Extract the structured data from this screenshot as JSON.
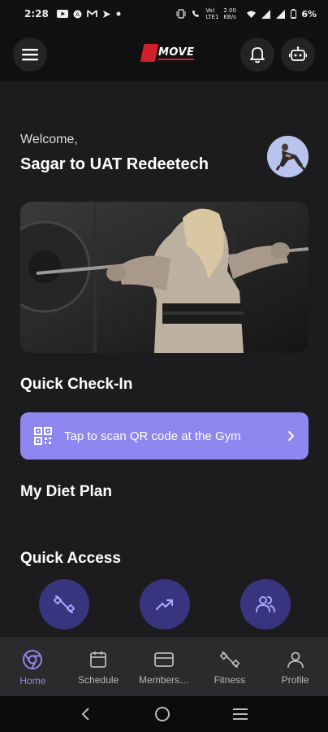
{
  "status_bar": {
    "time": "2:28",
    "battery": "6%",
    "network_speed": "2.00 KB/s",
    "network_type": "Vo) LTE1"
  },
  "header": {
    "logo_text": "MOVE",
    "icons": [
      "menu-icon",
      "bell-icon",
      "bot-icon"
    ]
  },
  "welcome": {
    "greeting": "Welcome,",
    "name": "Sagar to UAT Redeetech"
  },
  "sections": {
    "quick_checkin": "Quick Check-In",
    "qr_label": "Tap to scan QR code at the Gym",
    "diet_plan": "My Diet Plan",
    "quick_access": "Quick Access"
  },
  "quick_access_icons": [
    "dumbbell-icon",
    "trend-up-icon",
    "users-icon"
  ],
  "bottom_nav": {
    "items": [
      {
        "label": "Home",
        "icon": "home-icon",
        "active": true
      },
      {
        "label": "Schedule",
        "icon": "calendar-icon",
        "active": false
      },
      {
        "label": "Members…",
        "icon": "card-icon",
        "active": false
      },
      {
        "label": "Fitness",
        "icon": "dumbbell-icon",
        "active": false
      },
      {
        "label": "Profile",
        "icon": "person-icon",
        "active": false
      }
    ]
  },
  "colors": {
    "accent": "#8f87f0",
    "quick_access_bg": "#38357e",
    "background": "#1c1c1e",
    "brand_red": "#d0202a"
  }
}
